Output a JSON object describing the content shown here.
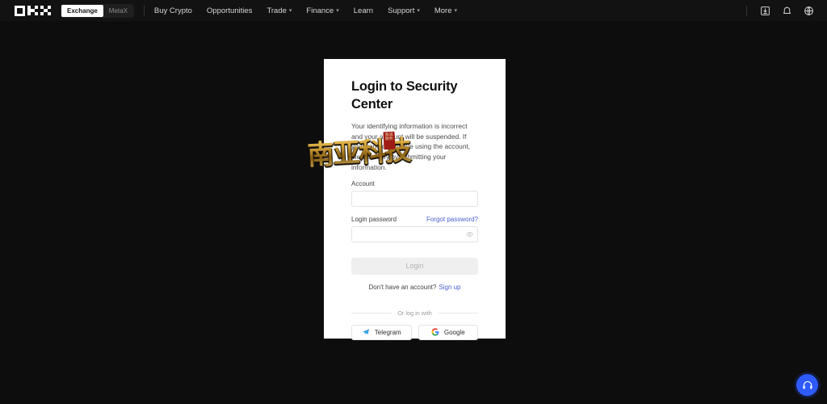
{
  "navbar": {
    "logo_name": "okx-logo",
    "toggle": {
      "exchange_label": "Exchange",
      "metax_label": "MetaX",
      "active": "Exchange"
    },
    "links": [
      {
        "label": "Buy Crypto",
        "caret": false
      },
      {
        "label": "Opportunities",
        "caret": false
      },
      {
        "label": "Trade",
        "caret": true
      },
      {
        "label": "Finance",
        "caret": true
      },
      {
        "label": "Learn",
        "caret": false
      },
      {
        "label": "Support",
        "caret": true
      },
      {
        "label": "More",
        "caret": true
      }
    ],
    "icons": [
      {
        "name": "app-download-icon"
      },
      {
        "name": "bell-icon"
      },
      {
        "name": "globe-icon"
      }
    ]
  },
  "card": {
    "title": "Login to Security Center",
    "description": "Your identifying information is incorrect and your account will be suspended. If you want to continue using the account, please verify by submitting your information.",
    "account": {
      "label": "Account",
      "value": "",
      "placeholder": ""
    },
    "password": {
      "label": "Login password",
      "forgot_label": "Forgot password?",
      "value": "",
      "placeholder": "",
      "toggle_icon": "eye-icon"
    },
    "login_button": {
      "label": "Login",
      "disabled": true
    },
    "signup": {
      "prompt": "Don't have an account?",
      "link_label": "Sign up"
    },
    "divider_label": "Or log in with",
    "social": [
      {
        "label": "Telegram",
        "icon": "telegram-icon"
      },
      {
        "label": "Google",
        "icon": "google-icon"
      }
    ]
  },
  "watermark": {
    "text": "南亚科技",
    "seal_text": "真诚服务"
  },
  "support": {
    "name": "support-headset-icon"
  },
  "colors": {
    "page_background": "#0d0d0d",
    "navbar_background": "#121212",
    "card_background": "#ffffff",
    "link_blue": "#4b61d1",
    "accent_blue": "#2e5bff",
    "disabled_button": "#efefef"
  }
}
